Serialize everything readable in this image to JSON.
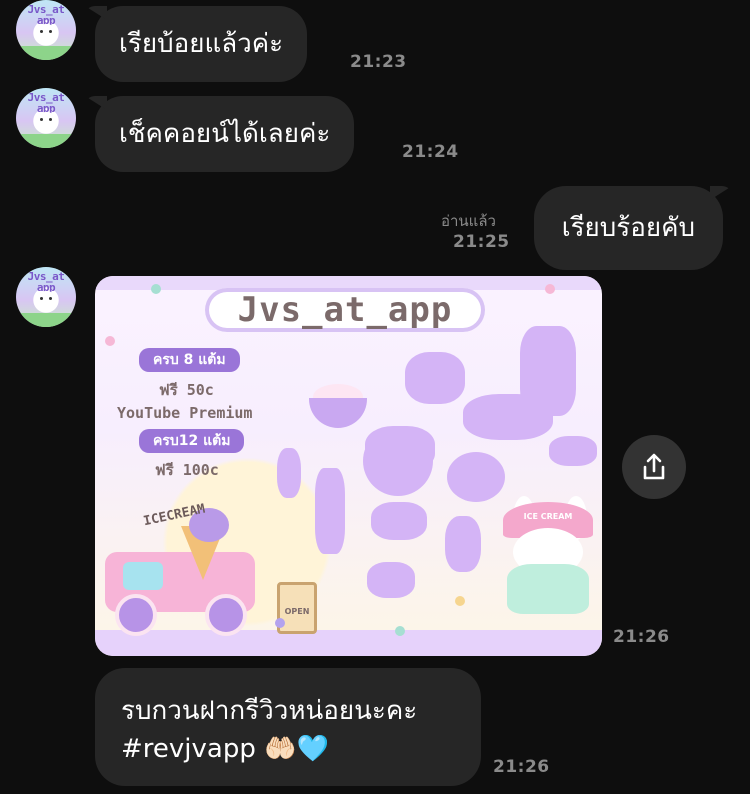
{
  "messages": [
    {
      "text": "เรียบ้อยแล้วค่ะ",
      "time": "21:23"
    },
    {
      "text": "เช็คคอยน์ได้เลยค่ะ",
      "time": "21:24"
    },
    {
      "text": "เรียบร้อยคับ",
      "time": "21:25",
      "read_label": "อ่านแล้ว"
    },
    {
      "time": "21:26"
    },
    {
      "line1": "รบกวนฝากรีวิวหน่อยนะคะ",
      "line2": "#revjvapp 🤲🏻🩵",
      "time": "21:26"
    }
  ],
  "avatar_text": "Jvs_at\napp",
  "image_card": {
    "logo": "Jvs_at_app",
    "pill1": "ครบ 8 แต้ม",
    "line1": "ฟรี 50c",
    "line2": "YouTube Premium",
    "pill2": "ครบ12 แต้ม",
    "line3": "ฟรี 100c",
    "truck_label": "ICECREAM",
    "sign_label": "OPEN",
    "hat_label": "ICE CREAM"
  },
  "colors": {
    "background": "#0e0e0e",
    "bubble": "#262626",
    "timestamp": "#8a8a8a",
    "card_purple": "#d4b4f6"
  },
  "icons": {
    "share": "share-icon"
  }
}
